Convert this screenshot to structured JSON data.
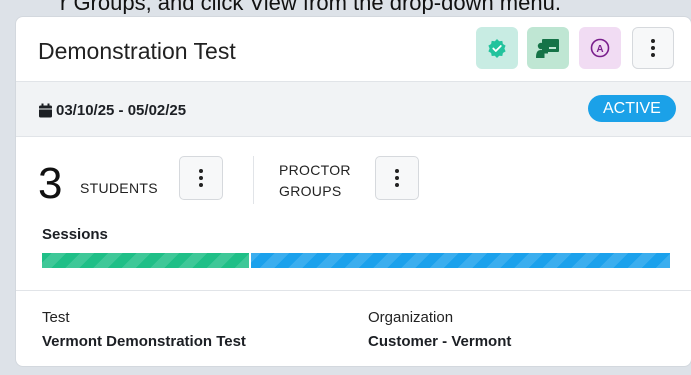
{
  "instruction_fragment": "r Groups, and click View from the drop-down menu.",
  "card": {
    "title": "Demonstration Test",
    "header_buttons": [
      {
        "name": "verified-icon",
        "color": "#1fbf98"
      },
      {
        "name": "whiteboard-icon",
        "color": "#157347"
      },
      {
        "name": "accommodation-icon",
        "label": "A",
        "color": "#7a1f8c"
      },
      {
        "name": "more-options-icon"
      }
    ],
    "date_range": "03/10/25 - 05/02/25",
    "status": "ACTIVE",
    "students": {
      "count": "3",
      "label": "STUDENTS"
    },
    "proctor_groups": {
      "line1": "PROCTOR",
      "line2": "GROUPS"
    },
    "sessions": {
      "label": "Sessions",
      "progress_fraction": 0.33,
      "completed_color": "#1fbf87",
      "remaining_color": "#1ba1ec"
    },
    "details": [
      {
        "label": "Test",
        "value": "Vermont Demonstration Test"
      },
      {
        "label": "Organization",
        "value": "Customer - Vermont"
      }
    ]
  }
}
